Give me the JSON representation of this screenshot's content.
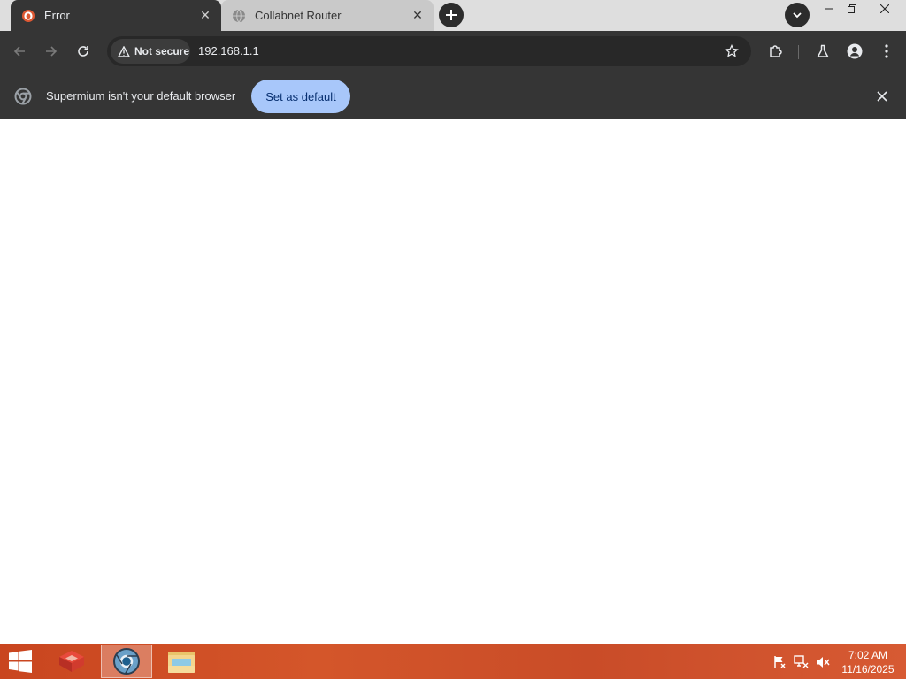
{
  "tabs": [
    {
      "title": "Error",
      "active": true,
      "favicon": "duckduckgo-icon"
    },
    {
      "title": "Collabnet Router",
      "active": false,
      "favicon": "globe-icon"
    }
  ],
  "toolbar": {
    "security_chip": "Not secure",
    "url": "192.168.1.1"
  },
  "infobar": {
    "message": "Supermium isn't your default browser",
    "button_label": "Set as default"
  },
  "taskbar": {
    "time": "7:02 AM",
    "date": "11/16/2025"
  },
  "colors": {
    "dark_chrome": "#353535",
    "omnibox": "#282828",
    "accent_button": "#a8c7fa",
    "taskbar": "#c9451f"
  }
}
